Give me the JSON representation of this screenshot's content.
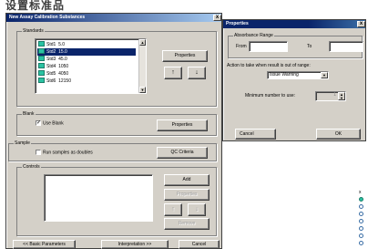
{
  "heading": "设置标准品",
  "main_dialog": {
    "title": "New Assay Calibration Substances",
    "close_label": "x",
    "standards": {
      "label": "Standards",
      "items": [
        {
          "name": "Std1",
          "value": "5.0",
          "selected": false
        },
        {
          "name": "Std2",
          "value": "15.0",
          "selected": true
        },
        {
          "name": "Std3",
          "value": "45.0",
          "selected": false
        },
        {
          "name": "Std4",
          "value": "1050",
          "selected": false
        },
        {
          "name": "Std5",
          "value": "4050",
          "selected": false
        },
        {
          "name": "Std6",
          "value": "12150",
          "selected": false
        }
      ],
      "properties_label": "Properties",
      "up_label": "↑",
      "down_label": "↓"
    },
    "blank": {
      "label": "Blank",
      "checkbox_label": "Use Blank",
      "checked": true,
      "properties_label": "Properties"
    },
    "sample": {
      "label": "Sample",
      "checkbox_label": "Run samples as doubles",
      "checked": false,
      "qc_label": "QC Criteria"
    },
    "controls": {
      "label": "Controls",
      "add_label": "Add",
      "properties_label": "Properties",
      "up_label": "↑",
      "down_label": "↓",
      "remove_label": "Remove"
    },
    "back_label": "<< Basic Parameters",
    "next_label": "Interpretation >>",
    "cancel_label": "Cancel"
  },
  "properties_dialog": {
    "title": "Properties",
    "close_label": "x",
    "range_label": "Absorbance Range",
    "from_label": "From",
    "to_label": "To",
    "from_value": "",
    "to_value": "",
    "action_label": "Action to take when result is out of range:",
    "action_value": "Issue Warning",
    "min_label": "Minimum number to use:",
    "min_value": "1",
    "cancel_label": "Cancel",
    "ok_label": "OK"
  },
  "side_strip": {
    "items": [
      "x",
      "",
      "",
      "",
      "",
      "",
      "",
      ""
    ]
  }
}
